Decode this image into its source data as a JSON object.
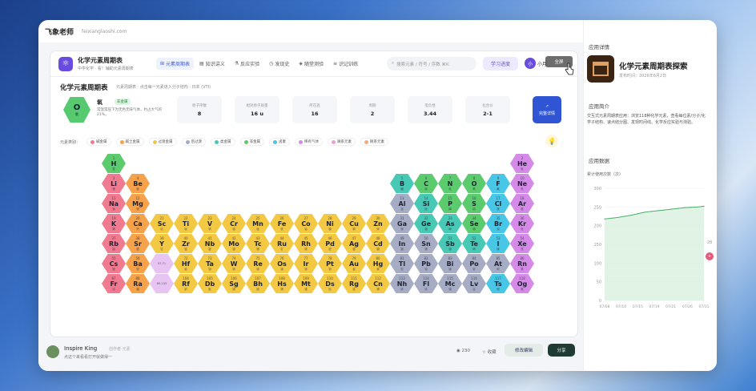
{
  "topbar": {
    "logo": "飞象老师",
    "url": "feixianglaoshi.com"
  },
  "app": {
    "icon": "⚛",
    "title": "化学元素周期表",
    "subtitle": "中学化学 · 看！辅助元素周期表",
    "nav": [
      {
        "icon": "⊞",
        "label": "元素周期表",
        "active": true
      },
      {
        "icon": "▤",
        "label": "知识讲义",
        "active": false
      },
      {
        "icon": "⚗",
        "label": "反应实验",
        "active": false
      },
      {
        "icon": "◷",
        "label": "发现史",
        "active": false
      },
      {
        "icon": "◈",
        "label": "随堂测验",
        "active": false
      },
      {
        "icon": "≡",
        "label": "识记训练",
        "active": false
      }
    ],
    "search_placeholder": "搜索元素 / 符号 / 序数  ⌘K",
    "progress_btn": "学习进度",
    "avatar": "小",
    "user": "小月",
    "tooltip": "全屏"
  },
  "page": {
    "title": "化学元素周期表",
    "subtitle": "元素周期表 · 点击每一元素进入分子结构 · 日本 (VTI)"
  },
  "element": {
    "symbol": "O",
    "name_small": "氧",
    "name": "氧",
    "tag": "非金属",
    "desc": "常温常压下为无色无味气体，约占大气的 21%。",
    "stats": [
      {
        "k": "原子序数",
        "v": "8"
      },
      {
        "k": "相对原子质量",
        "v": "16 u"
      },
      {
        "k": "所在族",
        "v": "16"
      },
      {
        "k": "周期",
        "v": "2"
      },
      {
        "k": "电负性",
        "v": "3.44"
      },
      {
        "k": "化合价",
        "v": "2-1"
      }
    ],
    "detail_btn": "完整详情"
  },
  "legend": {
    "label": "元素类别：",
    "items": [
      {
        "label": "碱金属",
        "color": "#f07a8f"
      },
      {
        "label": "碱土金属",
        "color": "#f5a24a"
      },
      {
        "label": "过渡金属",
        "color": "#f3c843"
      },
      {
        "label": "后过渡",
        "color": "#a5acc4"
      },
      {
        "label": "类金属",
        "color": "#47c9b6"
      },
      {
        "label": "非金属",
        "color": "#5ccb6d"
      },
      {
        "label": "卤素",
        "color": "#48c6e6"
      },
      {
        "label": "稀有气体",
        "color": "#d58ae8"
      },
      {
        "label": "镧系元素",
        "color": "#e7a2cf"
      },
      {
        "label": "锕系元素",
        "color": "#f5aa7a"
      }
    ]
  },
  "elements": [
    {
      "n": "1",
      "s": "H",
      "nm": "氢",
      "c": "non",
      "p": 1,
      "g": 1
    },
    {
      "n": "2",
      "s": "He",
      "nm": "氦",
      "c": "noble",
      "p": 1,
      "g": 18
    },
    {
      "n": "3",
      "s": "Li",
      "nm": "锂",
      "c": "alk",
      "p": 2,
      "g": 1
    },
    {
      "n": "4",
      "s": "Be",
      "nm": "铍",
      "c": "ae",
      "p": 2,
      "g": 2
    },
    {
      "n": "5",
      "s": "B",
      "nm": "硼",
      "c": "met",
      "p": 2,
      "g": 13
    },
    {
      "n": "6",
      "s": "C",
      "nm": "碳",
      "c": "non",
      "p": 2,
      "g": 14
    },
    {
      "n": "7",
      "s": "N",
      "nm": "氮",
      "c": "non",
      "p": 2,
      "g": 15
    },
    {
      "n": "8",
      "s": "O",
      "nm": "氧",
      "c": "non",
      "p": 2,
      "g": 16
    },
    {
      "n": "9",
      "s": "F",
      "nm": "氟",
      "c": "hal",
      "p": 2,
      "g": 17
    },
    {
      "n": "10",
      "s": "Ne",
      "nm": "氖",
      "c": "noble",
      "p": 2,
      "g": 18
    },
    {
      "n": "11",
      "s": "Na",
      "nm": "钠",
      "c": "alk",
      "p": 3,
      "g": 1
    },
    {
      "n": "12",
      "s": "Mg",
      "nm": "镁",
      "c": "ae",
      "p": 3,
      "g": 2
    },
    {
      "n": "13",
      "s": "Al",
      "nm": "铝",
      "c": "post",
      "p": 3,
      "g": 13
    },
    {
      "n": "14",
      "s": "Si",
      "nm": "硅",
      "c": "met",
      "p": 3,
      "g": 14
    },
    {
      "n": "15",
      "s": "P",
      "nm": "磷",
      "c": "non",
      "p": 3,
      "g": 15
    },
    {
      "n": "16",
      "s": "S",
      "nm": "硫",
      "c": "non",
      "p": 3,
      "g": 16
    },
    {
      "n": "17",
      "s": "Cl",
      "nm": "氯",
      "c": "hal",
      "p": 3,
      "g": 17
    },
    {
      "n": "18",
      "s": "Ar",
      "nm": "氩",
      "c": "noble",
      "p": 3,
      "g": 18
    },
    {
      "n": "19",
      "s": "K",
      "nm": "钾",
      "c": "alk",
      "p": 4,
      "g": 1
    },
    {
      "n": "20",
      "s": "Ca",
      "nm": "钙",
      "c": "ae",
      "p": 4,
      "g": 2
    },
    {
      "n": "21",
      "s": "Sc",
      "nm": "钪",
      "c": "tm",
      "p": 4,
      "g": 3
    },
    {
      "n": "22",
      "s": "Ti",
      "nm": "钛",
      "c": "tm",
      "p": 4,
      "g": 4
    },
    {
      "n": "23",
      "s": "V",
      "nm": "钒",
      "c": "tm",
      "p": 4,
      "g": 5
    },
    {
      "n": "24",
      "s": "Cr",
      "nm": "铬",
      "c": "tm",
      "p": 4,
      "g": 6
    },
    {
      "n": "25",
      "s": "Mn",
      "nm": "锰",
      "c": "tm",
      "p": 4,
      "g": 7
    },
    {
      "n": "26",
      "s": "Fe",
      "nm": "铁",
      "c": "tm",
      "p": 4,
      "g": 8
    },
    {
      "n": "27",
      "s": "Co",
      "nm": "钴",
      "c": "tm",
      "p": 4,
      "g": 9
    },
    {
      "n": "28",
      "s": "Ni",
      "nm": "镍",
      "c": "tm",
      "p": 4,
      "g": 10
    },
    {
      "n": "29",
      "s": "Cu",
      "nm": "铜",
      "c": "tm",
      "p": 4,
      "g": 11
    },
    {
      "n": "30",
      "s": "Zn",
      "nm": "锌",
      "c": "tm",
      "p": 4,
      "g": 12
    },
    {
      "n": "31",
      "s": "Ga",
      "nm": "镓",
      "c": "post",
      "p": 4,
      "g": 13
    },
    {
      "n": "32",
      "s": "Ge",
      "nm": "锗",
      "c": "met",
      "p": 4,
      "g": 14
    },
    {
      "n": "33",
      "s": "As",
      "nm": "砷",
      "c": "met",
      "p": 4,
      "g": 15
    },
    {
      "n": "34",
      "s": "Se",
      "nm": "硒",
      "c": "non",
      "p": 4,
      "g": 16
    },
    {
      "n": "35",
      "s": "Br",
      "nm": "溴",
      "c": "hal",
      "p": 4,
      "g": 17
    },
    {
      "n": "36",
      "s": "Kr",
      "nm": "氪",
      "c": "noble",
      "p": 4,
      "g": 18
    },
    {
      "n": "37",
      "s": "Rb",
      "nm": "铷",
      "c": "alk",
      "p": 5,
      "g": 1
    },
    {
      "n": "38",
      "s": "Sr",
      "nm": "锶",
      "c": "ae",
      "p": 5,
      "g": 2
    },
    {
      "n": "39",
      "s": "Y",
      "nm": "钇",
      "c": "tm",
      "p": 5,
      "g": 3
    },
    {
      "n": "40",
      "s": "Zr",
      "nm": "锆",
      "c": "tm",
      "p": 5,
      "g": 4
    },
    {
      "n": "41",
      "s": "Nb",
      "nm": "铌",
      "c": "tm",
      "p": 5,
      "g": 5
    },
    {
      "n": "42",
      "s": "Mo",
      "nm": "钼",
      "c": "tm",
      "p": 5,
      "g": 6
    },
    {
      "n": "43",
      "s": "Tc",
      "nm": "锝",
      "c": "tm",
      "p": 5,
      "g": 7
    },
    {
      "n": "44",
      "s": "Ru",
      "nm": "钌",
      "c": "tm",
      "p": 5,
      "g": 8
    },
    {
      "n": "45",
      "s": "Rh",
      "nm": "铑",
      "c": "tm",
      "p": 5,
      "g": 9
    },
    {
      "n": "46",
      "s": "Pd",
      "nm": "钯",
      "c": "tm",
      "p": 5,
      "g": 10
    },
    {
      "n": "47",
      "s": "Ag",
      "nm": "银",
      "c": "tm",
      "p": 5,
      "g": 11
    },
    {
      "n": "48",
      "s": "Cd",
      "nm": "镉",
      "c": "tm",
      "p": 5,
      "g": 12
    },
    {
      "n": "49",
      "s": "In",
      "nm": "铟",
      "c": "post",
      "p": 5,
      "g": 13
    },
    {
      "n": "50",
      "s": "Sn",
      "nm": "锡",
      "c": "post",
      "p": 5,
      "g": 14
    },
    {
      "n": "51",
      "s": "Sb",
      "nm": "锑",
      "c": "met",
      "p": 5,
      "g": 15
    },
    {
      "n": "52",
      "s": "Te",
      "nm": "碲",
      "c": "met",
      "p": 5,
      "g": 16
    },
    {
      "n": "53",
      "s": "I",
      "nm": "碘",
      "c": "hal",
      "p": 5,
      "g": 17
    },
    {
      "n": "54",
      "s": "Xe",
      "nm": "氙",
      "c": "noble",
      "p": 5,
      "g": 18
    },
    {
      "n": "55",
      "s": "Cs",
      "nm": "铯",
      "c": "alk",
      "p": 6,
      "g": 1
    },
    {
      "n": "56",
      "s": "Ba",
      "nm": "钡",
      "c": "ae",
      "p": 6,
      "g": 2
    },
    {
      "n": "",
      "s": "",
      "nm": "57-71",
      "c": "lan",
      "p": 6,
      "g": 3
    },
    {
      "n": "72",
      "s": "Hf",
      "nm": "铪",
      "c": "tm",
      "p": 6,
      "g": 4
    },
    {
      "n": "73",
      "s": "Ta",
      "nm": "钽",
      "c": "tm",
      "p": 6,
      "g": 5
    },
    {
      "n": "74",
      "s": "W",
      "nm": "钨",
      "c": "tm",
      "p": 6,
      "g": 6
    },
    {
      "n": "75",
      "s": "Re",
      "nm": "铼",
      "c": "tm",
      "p": 6,
      "g": 7
    },
    {
      "n": "76",
      "s": "Os",
      "nm": "锇",
      "c": "tm",
      "p": 6,
      "g": 8
    },
    {
      "n": "77",
      "s": "Ir",
      "nm": "铱",
      "c": "tm",
      "p": 6,
      "g": 9
    },
    {
      "n": "78",
      "s": "Pt",
      "nm": "铂",
      "c": "tm",
      "p": 6,
      "g": 10
    },
    {
      "n": "79",
      "s": "Au",
      "nm": "金",
      "c": "tm",
      "p": 6,
      "g": 11
    },
    {
      "n": "80",
      "s": "Hg",
      "nm": "汞",
      "c": "tm",
      "p": 6,
      "g": 12
    },
    {
      "n": "81",
      "s": "Tl",
      "nm": "铊",
      "c": "post",
      "p": 6,
      "g": 13
    },
    {
      "n": "82",
      "s": "Pb",
      "nm": "铅",
      "c": "post",
      "p": 6,
      "g": 14
    },
    {
      "n": "83",
      "s": "Bi",
      "nm": "铋",
      "c": "post",
      "p": 6,
      "g": 15
    },
    {
      "n": "84",
      "s": "Po",
      "nm": "钋",
      "c": "post",
      "p": 6,
      "g": 16
    },
    {
      "n": "85",
      "s": "At",
      "nm": "砹",
      "c": "post",
      "p": 6,
      "g": 17
    },
    {
      "n": "86",
      "s": "Rn",
      "nm": "氡",
      "c": "noble",
      "p": 6,
      "g": 18
    },
    {
      "n": "87",
      "s": "Fr",
      "nm": "钫",
      "c": "alk",
      "p": 7,
      "g": 1
    },
    {
      "n": "88",
      "s": "Ra",
      "nm": "镭",
      "c": "ae",
      "p": 7,
      "g": 2
    },
    {
      "n": "",
      "s": "",
      "nm": "89-103",
      "c": "lan",
      "p": 7,
      "g": 3
    },
    {
      "n": "104",
      "s": "Rf",
      "nm": "𬬻",
      "c": "tm",
      "p": 7,
      "g": 4
    },
    {
      "n": "105",
      "s": "Db",
      "nm": "𬭊",
      "c": "tm",
      "p": 7,
      "g": 5
    },
    {
      "n": "106",
      "s": "Sg",
      "nm": "𬭳",
      "c": "tm",
      "p": 7,
      "g": 6
    },
    {
      "n": "107",
      "s": "Bh",
      "nm": "𬭛",
      "c": "tm",
      "p": 7,
      "g": 7
    },
    {
      "n": "108",
      "s": "Hs",
      "nm": "𬭶",
      "c": "tm",
      "p": 7,
      "g": 8
    },
    {
      "n": "109",
      "s": "Mt",
      "nm": "鿏",
      "c": "tm",
      "p": 7,
      "g": 9
    },
    {
      "n": "110",
      "s": "Ds",
      "nm": "𫟼",
      "c": "tm",
      "p": 7,
      "g": 10
    },
    {
      "n": "111",
      "s": "Rg",
      "nm": "𬬭",
      "c": "tm",
      "p": 7,
      "g": 11
    },
    {
      "n": "112",
      "s": "Cn",
      "nm": "鿔",
      "c": "tm",
      "p": 7,
      "g": 12
    },
    {
      "n": "113",
      "s": "Nh",
      "nm": "鿭",
      "c": "post",
      "p": 7,
      "g": 13
    },
    {
      "n": "114",
      "s": "Fl",
      "nm": "𫓧",
      "c": "post",
      "p": 7,
      "g": 14
    },
    {
      "n": "115",
      "s": "Mc",
      "nm": "镆",
      "c": "post",
      "p": 7,
      "g": 15
    },
    {
      "n": "116",
      "s": "Lv",
      "nm": "𫟷",
      "c": "post",
      "p": 7,
      "g": 16
    },
    {
      "n": "117",
      "s": "Ts",
      "nm": "鿬",
      "c": "hal",
      "p": 7,
      "g": 17
    },
    {
      "n": "118",
      "s": "Og",
      "nm": "鿫",
      "c": "noble",
      "p": 7,
      "g": 18
    }
  ],
  "cat_colors": {
    "alk": "#f07a8f",
    "ae": "#f5a24a",
    "tm": "#f3c843",
    "post": "#a5acc4",
    "met": "#47c9b6",
    "non": "#5ccb6d",
    "hal": "#48c6e6",
    "noble": "#d58ae8",
    "lan": "#e7c4f2"
  },
  "bottom": {
    "author": "Inspire King",
    "author_meta": "创作者·元素",
    "desc": "点这个来看看打开就做得一",
    "views": "◉ 230",
    "fav": "☆ 收藏",
    "remix": "修改编辑",
    "share": "分享"
  },
  "side": {
    "h1": "应用详情",
    "name": "化学元素周期表探索",
    "date": "发布时间：2026年6月2日",
    "h2": "应用简介",
    "desc": "交互式元素周期表应用：浏览118种化学元素，查看每位素/分子/化学子结构、速点结分图、发现时间线、化学反应实验与测验。",
    "h3": "应用数据",
    "chart_label": "累计使用次数（次）",
    "side_num": "28",
    "side_btn": "+"
  },
  "chart_data": {
    "type": "area",
    "x": [
      "07/08",
      "07/10",
      "07/12",
      "07/14",
      "07/16",
      "07/18",
      "07/20",
      "07/21",
      "07/22",
      "07/24",
      "07/25",
      "07/26",
      "07/27",
      "07/28",
      "07/29",
      "07/30"
    ],
    "values": [
      218,
      220,
      222,
      225,
      228,
      232,
      236,
      238,
      240,
      242,
      244,
      246,
      248,
      249,
      250,
      252
    ],
    "ylim": [
      0,
      300
    ],
    "yticks": [
      0,
      50,
      100,
      150,
      200,
      250,
      300
    ],
    "xticks": [
      "07/08",
      "07/10",
      "07/15",
      "07/19",
      "07/21",
      "07/26",
      "07/31"
    ],
    "color": "#4caf6a"
  }
}
